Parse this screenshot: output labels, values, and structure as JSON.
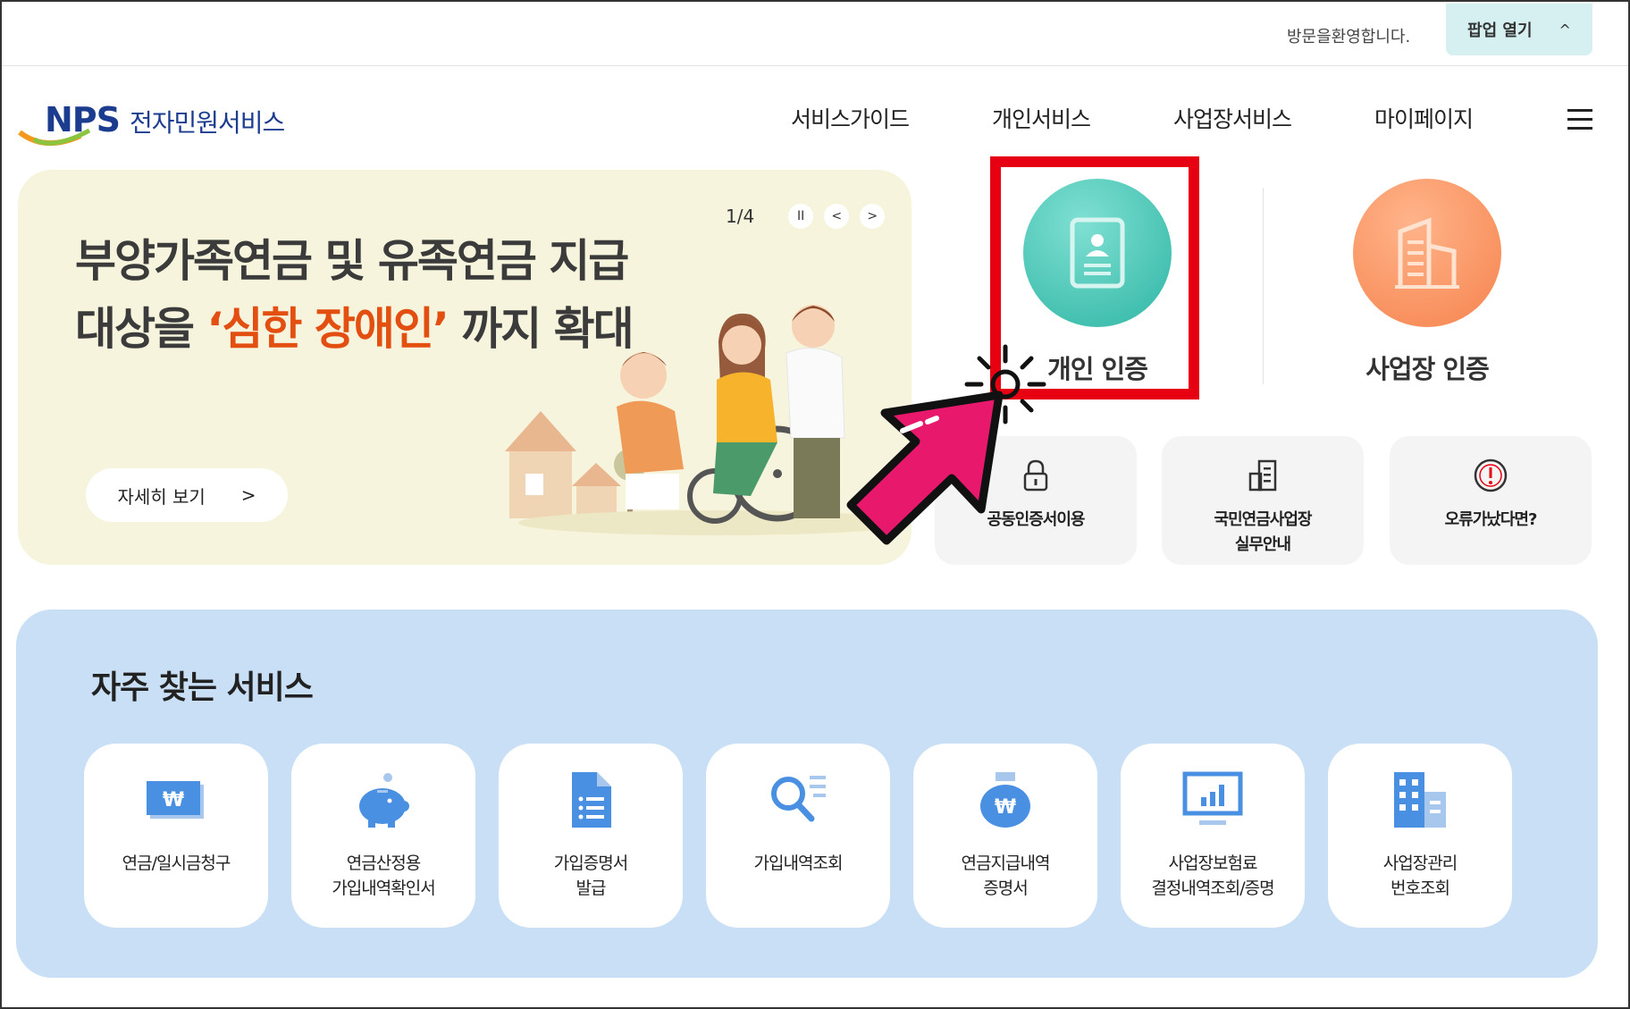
{
  "topbar": {
    "welcome": "방문을환영합니다.",
    "popup_label": "팝업 열기",
    "popup_caret": "^"
  },
  "header": {
    "brand": "NPS",
    "brand_sub": "전자민원서비스",
    "nav": [
      "서비스가이드",
      "개인서비스",
      "사업장서비스",
      "마이페이지"
    ]
  },
  "banner": {
    "line1": "부양가족연금 및 유족연금 지급",
    "line2_pre": "대상을 ",
    "line2_hl": "‘심한 장애인’",
    "line2_post": " 까지 확대",
    "counter": "1/4",
    "pause": "II",
    "prev": "<",
    "next": ">",
    "more": "자세히 보기",
    "more_arrow": ">"
  },
  "auth": {
    "personal": "개인 인증",
    "business": "사업장 인증"
  },
  "quick": [
    {
      "label": "공동인증서이용",
      "icon": "lock-icon"
    },
    {
      "label1": "국민연금사업장",
      "label2": "실무안내",
      "icon": "document-building-icon"
    },
    {
      "label": "오류가났다면?",
      "icon": "alert-icon"
    }
  ],
  "frequent": {
    "title": "자주 찾는 서비스",
    "items": [
      {
        "l1": "연금/일시금청구",
        "l2": "",
        "icon": "won-bill-icon"
      },
      {
        "l1": "연금산정용",
        "l2": "가입내역확인서",
        "icon": "piggy-bank-icon"
      },
      {
        "l1": "가입증명서",
        "l2": "발급",
        "icon": "document-icon"
      },
      {
        "l1": "가입내역조회",
        "l2": "",
        "icon": "search-list-icon"
      },
      {
        "l1": "연금지급내역",
        "l2": "증명서",
        "icon": "money-bag-icon"
      },
      {
        "l1": "사업장보험료",
        "l2": "결정내역조회/증명",
        "icon": "monitor-chart-icon"
      },
      {
        "l1": "사업장관리",
        "l2": "번호조회",
        "icon": "building-icon"
      }
    ]
  },
  "colors": {
    "accent_teal": "#2fb5a4",
    "accent_orange": "#f6834e",
    "highlight": "#e60012",
    "service_bg": "#c9dff5",
    "icon_blue": "#4a90e2"
  }
}
